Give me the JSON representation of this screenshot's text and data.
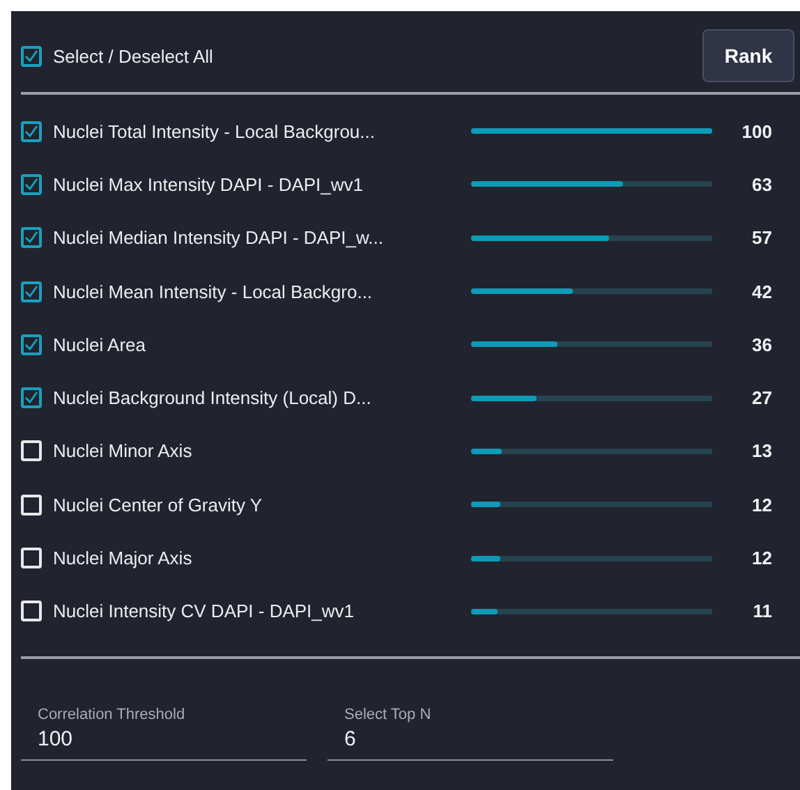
{
  "select_all": {
    "label": "Select / Deselect All",
    "checked": true
  },
  "rank_button": "Rank",
  "features": [
    {
      "name": "Nuclei Total Intensity - Local Backgrou...",
      "checked": true,
      "level": 1.0,
      "score": "100"
    },
    {
      "name": "Nuclei Max Intensity DAPI - DAPI_wv1",
      "checked": true,
      "level": 0.63,
      "score": "63"
    },
    {
      "name": "Nuclei Median Intensity DAPI - DAPI_w...",
      "checked": true,
      "level": 0.57,
      "score": "57"
    },
    {
      "name": "Nuclei Mean Intensity - Local Backgro...",
      "checked": true,
      "level": 0.42,
      "score": "42"
    },
    {
      "name": "Nuclei Area",
      "checked": true,
      "level": 0.36,
      "score": "36"
    },
    {
      "name": "Nuclei Background Intensity (Local) D...",
      "checked": true,
      "level": 0.27,
      "score": "27"
    },
    {
      "name": "Nuclei Minor Axis",
      "checked": false,
      "level": 0.13,
      "score": "13"
    },
    {
      "name": "Nuclei Center of Gravity Y",
      "checked": false,
      "level": 0.12,
      "score": "12"
    },
    {
      "name": "Nuclei Major Axis",
      "checked": false,
      "level": 0.12,
      "score": "12"
    },
    {
      "name": "Nuclei Intensity CV DAPI - DAPI_wv1",
      "checked": false,
      "level": 0.11,
      "score": "11"
    }
  ],
  "fields": [
    {
      "label": "Correlation Threshold",
      "value": "100"
    },
    {
      "label": "Select Top N",
      "value": "6"
    }
  ]
}
